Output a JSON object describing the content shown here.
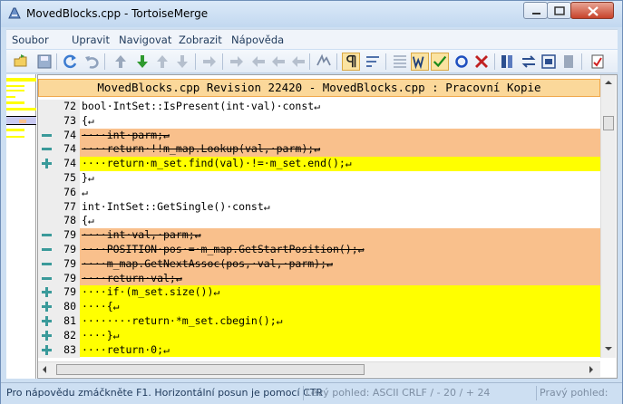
{
  "window": {
    "title": "MovedBlocks.cpp - TortoiseMerge"
  },
  "menu": [
    "Soubor",
    "Upravit",
    "Navigovat",
    "Zobrazit",
    "Nápověda"
  ],
  "view": {
    "header": "MovedBlocks.cpp Revision 22420 - MovedBlocks.cpp : Pracovní Kopie",
    "lines": [
      {
        "num": "72",
        "state": "normal",
        "text": "bool·IntSet::IsPresent(int·val)·const↵"
      },
      {
        "num": "73",
        "state": "normal",
        "text": "{↵"
      },
      {
        "num": "74",
        "state": "removed",
        "text": "····int·parm;↵"
      },
      {
        "num": "74",
        "state": "removed",
        "text": "····return·!!m_map.Lookup(val,·parm);↵"
      },
      {
        "num": "74",
        "state": "added",
        "text": "····return·m_set.find(val)·!=·m_set.end();↵"
      },
      {
        "num": "75",
        "state": "normal",
        "text": "}↵"
      },
      {
        "num": "76",
        "state": "normal",
        "text": "↵"
      },
      {
        "num": "77",
        "state": "normal",
        "text": "int·IntSet::GetSingle()·const↵"
      },
      {
        "num": "78",
        "state": "normal",
        "text": "{↵"
      },
      {
        "num": "79",
        "state": "removed",
        "text": "····int·val,·parm;↵"
      },
      {
        "num": "79",
        "state": "removed",
        "text": "····POSITION·pos·=·m_map.GetStartPosition();↵"
      },
      {
        "num": "79",
        "state": "removed",
        "text": "····m_map.GetNextAssoc(pos,·val,·parm);↵"
      },
      {
        "num": "79",
        "state": "removed",
        "text": "····return·val;↵"
      },
      {
        "num": "79",
        "state": "added",
        "text": "····if·(m_set.size())↵"
      },
      {
        "num": "80",
        "state": "added",
        "text": "····{↵"
      },
      {
        "num": "81",
        "state": "added",
        "text": "········return·*m_set.cbegin();↵"
      },
      {
        "num": "82",
        "state": "added",
        "text": "····}↵"
      },
      {
        "num": "83",
        "state": "added",
        "text": "····return·0;↵"
      },
      {
        "num": "",
        "state": "normal",
        "text": ""
      }
    ]
  },
  "status": {
    "help": "Pro nápovědu zmáčkněte F1. Horizontální posun je pomocí CTR",
    "left_view": "Levý pohled: ASCII CRLF  / - 20 / + 24",
    "right_view": "Pravý pohled:"
  },
  "colors": {
    "removed": "#f9c08c",
    "added": "#ffff00",
    "header": "#fbd89a"
  }
}
